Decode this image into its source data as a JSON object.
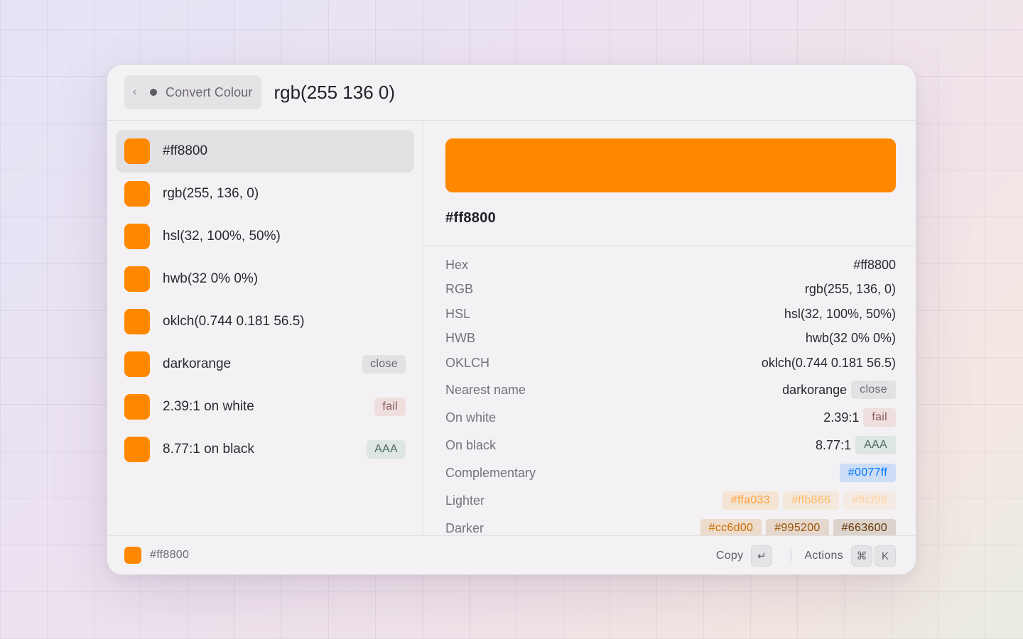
{
  "header": {
    "back_chevron": "‹",
    "crumb_label": "Convert Colour",
    "query": "rgb(255 136 0)"
  },
  "colors": {
    "orange": "#ff8800",
    "complement": "#0077ff",
    "lighter": [
      "#ffa033",
      "#ffb866",
      "#ffcf99"
    ],
    "darker": [
      "#cc6d00",
      "#995200",
      "#663600"
    ]
  },
  "list": {
    "items": [
      {
        "text": "#ff8800",
        "badge": ""
      },
      {
        "text": "rgb(255, 136, 0)",
        "badge": ""
      },
      {
        "text": "hsl(32, 100%, 50%)",
        "badge": ""
      },
      {
        "text": "hwb(32 0% 0%)",
        "badge": ""
      },
      {
        "text": "oklch(0.744 0.181 56.5)",
        "badge": ""
      },
      {
        "text": "darkorange",
        "badge": "close"
      },
      {
        "text": "2.39:1 on white",
        "badge": "fail"
      },
      {
        "text": "8.77:1 on black",
        "badge": "AAA"
      }
    ]
  },
  "detail": {
    "title": "#ff8800",
    "rows": [
      {
        "key": "Hex",
        "value": "#ff8800"
      },
      {
        "key": "RGB",
        "value": "rgb(255, 136, 0)"
      },
      {
        "key": "HSL",
        "value": "hsl(32, 100%, 50%)"
      },
      {
        "key": "HWB",
        "value": "hwb(32 0% 0%)"
      },
      {
        "key": "OKLCH",
        "value": "oklch(0.744 0.181 56.5)"
      },
      {
        "key": "Nearest name",
        "value": "darkorange",
        "badge": "close"
      },
      {
        "key": "On white",
        "value": "2.39:1",
        "badge": "fail"
      },
      {
        "key": "On black",
        "value": "8.77:1",
        "badge": "AAA"
      },
      {
        "key": "Complementary",
        "chips": [
          "#0077ff"
        ]
      },
      {
        "key": "Lighter",
        "chips": [
          "#ffa033",
          "#ffb866",
          "#ffcf99"
        ]
      },
      {
        "key": "Darker",
        "chips": [
          "#cc6d00",
          "#995200",
          "#663600"
        ]
      }
    ]
  },
  "footer": {
    "selected_text": "#ff8800",
    "copy_label": "Copy",
    "copy_key": "↵",
    "actions_label": "Actions",
    "actions_key_1": "⌘",
    "actions_key_2": "K"
  }
}
